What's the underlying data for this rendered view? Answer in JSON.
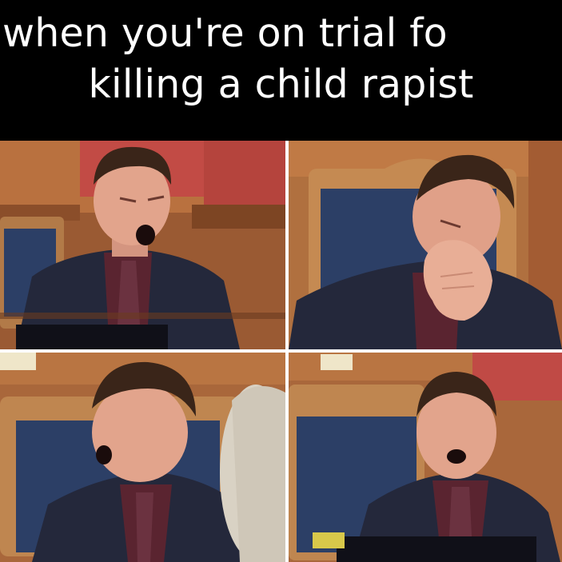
{
  "caption": {
    "line1": "when you're on trial fo",
    "line2": "killing a child rapist"
  },
  "panels": [
    {
      "name": "panel-top-left",
      "description_icon": "yawning-man-photo"
    },
    {
      "name": "panel-top-right",
      "description_icon": "yawning-man-hand-photo"
    },
    {
      "name": "panel-bottom-left",
      "description_icon": "yawning-man-profile-photo"
    },
    {
      "name": "panel-bottom-right",
      "description_icon": "yawning-man-photo"
    }
  ],
  "colors": {
    "background": "#000000",
    "caption_text": "#ffffff",
    "wood": "#a8643a",
    "chair_blue": "#2c3f66",
    "suit": "#24283b",
    "skin": "#e2a48c"
  }
}
